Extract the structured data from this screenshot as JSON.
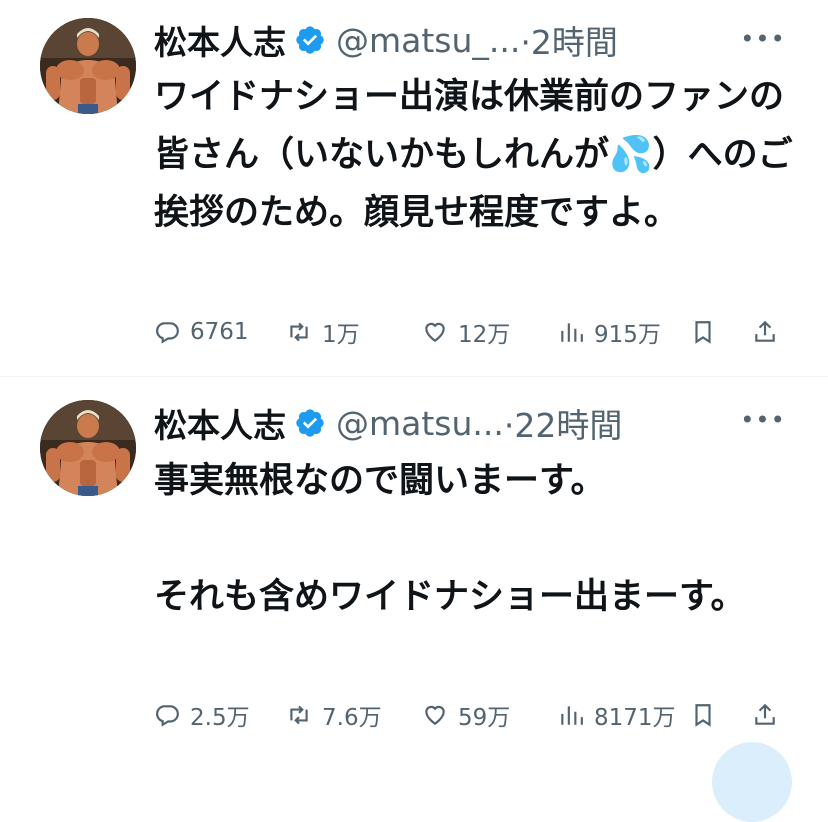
{
  "tweets": [
    {
      "author_name": "松本人志",
      "handle": "@matsu_...",
      "time": "·2時間",
      "text": "ワイドナショー出演は休業前のファンの皆さん（いないかもしれんが💦）へのご挨拶のため。顔見せ程度ですよ。",
      "reply_count": "6761",
      "retweet_count": "1万",
      "like_count": "12万",
      "view_count": "915万"
    },
    {
      "author_name": "松本人志",
      "handle": "@matsu...",
      "time": "·22時間",
      "text": "事実無根なので闘いまーす。\n\nそれも含めワイドナショー出まーす。",
      "reply_count": "2.5万",
      "retweet_count": "7.6万",
      "like_count": "59万",
      "view_count": "8171万"
    }
  ],
  "icons": {
    "verified": "verified-badge-icon",
    "more": "more-icon",
    "reply": "reply-icon",
    "retweet": "retweet-icon",
    "like": "heart-icon",
    "views": "views-icon",
    "bookmark": "bookmark-icon",
    "share": "share-icon"
  },
  "colors": {
    "verified": "#1d9bf0",
    "secondary_text": "#536471",
    "primary_text": "#0f1419"
  }
}
